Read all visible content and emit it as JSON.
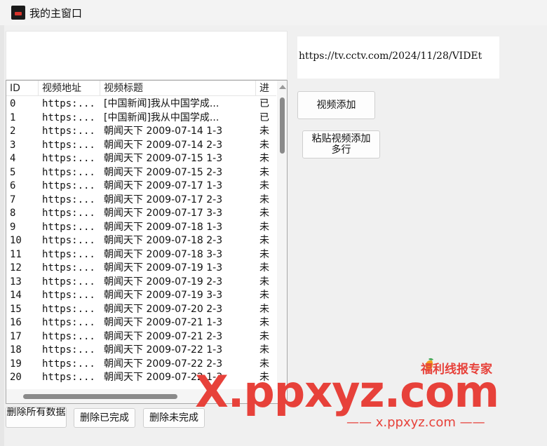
{
  "window": {
    "title": "我的主窗口"
  },
  "url_field": {
    "value": "https://tv.cctv.com/2024/11/28/VIDEt"
  },
  "buttons": {
    "add_video": "视频添加",
    "paste_line1": "粘贴视频添加",
    "paste_line2": "多行",
    "delete_all": "删除所有数据",
    "delete_done": "删除已完成",
    "delete_undone": "删除未完成"
  },
  "table": {
    "headers": [
      "ID",
      "视频地址",
      "视频标题",
      "进"
    ],
    "rows": [
      [
        "0",
        "https:...",
        "[中国新闻]我从中国学成...",
        "已"
      ],
      [
        "1",
        "https:...",
        "[中国新闻]我从中国学成...",
        "已"
      ],
      [
        "2",
        "https:...",
        "朝闻天下 2009-07-14 1-3",
        "未"
      ],
      [
        "3",
        "https:...",
        "朝闻天下 2009-07-14 2-3",
        "未"
      ],
      [
        "4",
        "https:...",
        "朝闻天下 2009-07-15 1-3",
        "未"
      ],
      [
        "5",
        "https:...",
        "朝闻天下 2009-07-15 2-3",
        "未"
      ],
      [
        "6",
        "https:...",
        "朝闻天下 2009-07-17 1-3",
        "未"
      ],
      [
        "7",
        "https:...",
        "朝闻天下 2009-07-17 2-3",
        "未"
      ],
      [
        "8",
        "https:...",
        "朝闻天下 2009-07-17 3-3",
        "未"
      ],
      [
        "9",
        "https:...",
        "朝闻天下 2009-07-18 1-3",
        "未"
      ],
      [
        "10",
        "https:...",
        "朝闻天下 2009-07-18 2-3",
        "未"
      ],
      [
        "11",
        "https:...",
        "朝闻天下 2009-07-18 3-3",
        "未"
      ],
      [
        "12",
        "https:...",
        "朝闻天下 2009-07-19 1-3",
        "未"
      ],
      [
        "13",
        "https:...",
        "朝闻天下 2009-07-19 2-3",
        "未"
      ],
      [
        "14",
        "https:...",
        "朝闻天下 2009-07-19 3-3",
        "未"
      ],
      [
        "15",
        "https:...",
        "朝闻天下 2009-07-20 2-3",
        "未"
      ],
      [
        "16",
        "https:...",
        "朝闻天下 2009-07-21 1-3",
        "未"
      ],
      [
        "17",
        "https:...",
        "朝闻天下 2009-07-21 2-3",
        "未"
      ],
      [
        "18",
        "https:...",
        "朝闻天下 2009-07-22 1-3",
        "未"
      ],
      [
        "19",
        "https:...",
        "朝闻天下 2009-07-22 2-3",
        "未"
      ],
      [
        "20",
        "https:...",
        "朝闻天下 2009-07-22 1-3",
        "未"
      ]
    ]
  },
  "watermark": {
    "main": "X.ppxyz.com",
    "sub": "—— x.ppxyz.com ——",
    "brand": "福利线报专家"
  },
  "colors": {
    "watermark": "#e7413a",
    "scroll_thumb": "#8a8a8a"
  },
  "icons": {
    "app": "app-icon"
  }
}
